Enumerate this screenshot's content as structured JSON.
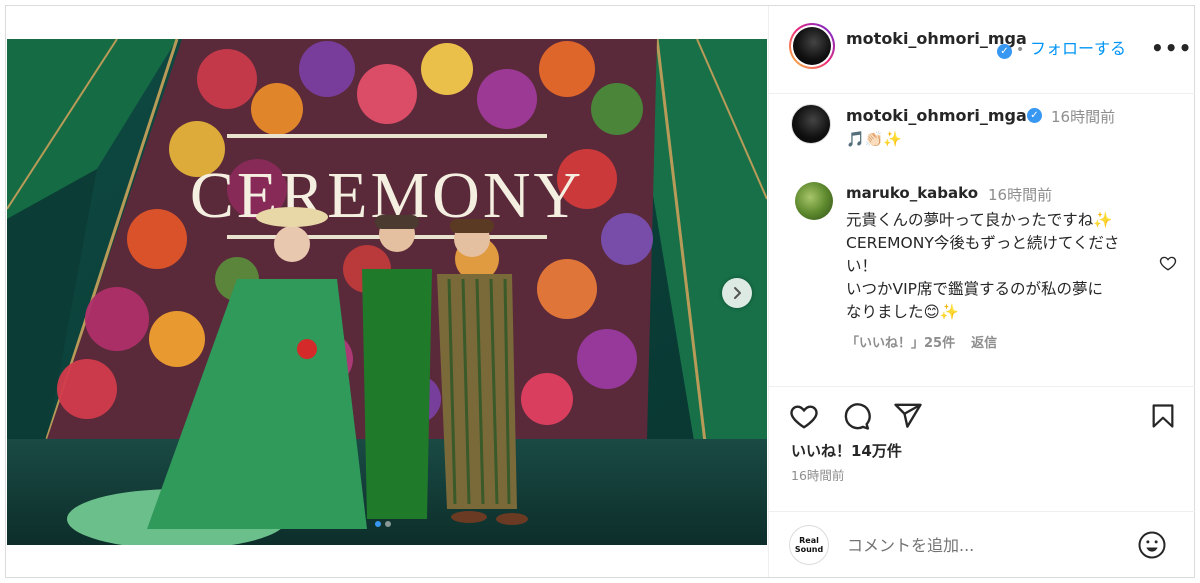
{
  "post": {
    "photo_text": "CEREMONY",
    "carousel": {
      "total": 2,
      "active": 1
    }
  },
  "header": {
    "username": "motoki_ohmori_mga",
    "separator": "•",
    "follow_label": "フォローする",
    "more_label": "•••"
  },
  "caption": {
    "username": "motoki_ohmori_mga",
    "time": "16時間前",
    "text": "🎵👏🏻✨"
  },
  "comment": {
    "username": "maruko_kabako",
    "time": "16時間前",
    "lines": [
      "元貴くんの夢叶って良かったですね✨",
      "CEREMONY今後もずっと続けてくださ",
      "い！",
      "いつかVIP席で鑑賞するのが私の夢に",
      "なりました😊✨"
    ],
    "likes_label": "「いいね！」25件",
    "reply_label": "返信"
  },
  "stats": {
    "likes": "いいね！14万件",
    "time": "16時間前"
  },
  "composer": {
    "avatar_line1": "Real",
    "avatar_line2": "Sound",
    "placeholder": "コメントを追加..."
  },
  "icons": {
    "verified": "verified-badge-icon",
    "heart": "heart-icon",
    "comment": "comment-icon",
    "share": "share-icon",
    "save": "bookmark-icon",
    "emoji": "emoji-icon",
    "next": "chevron-right-icon"
  },
  "colors": {
    "accent": "#0095f6",
    "verified": "#3897f0",
    "muted": "#8e8e8e"
  }
}
